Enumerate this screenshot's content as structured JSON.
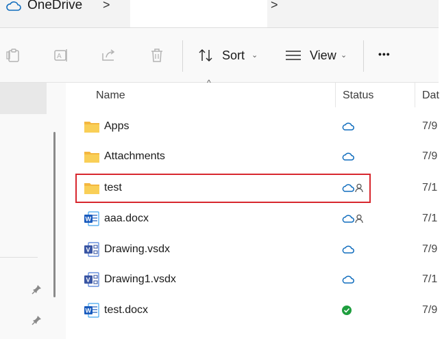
{
  "breadcrumb": {
    "title": "OneDrive",
    "separator": ">"
  },
  "toolbar": {
    "sort_label": "Sort",
    "view_label": "View",
    "more_label": "•••",
    "dropdown_glyph": "⌄",
    "icons": [
      "paste-icon",
      "rename-icon",
      "share-icon",
      "delete-icon",
      "sort-arrows-icon",
      "view-lines-icon",
      "more-icon"
    ]
  },
  "columns": {
    "name": "Name",
    "status": "Status",
    "date": "Dat"
  },
  "sort_indicator": "^",
  "files": [
    {
      "name": "Apps",
      "type": "folder",
      "status": "cloud",
      "date": "7/9"
    },
    {
      "name": "Attachments",
      "type": "folder",
      "status": "cloud",
      "date": "7/9"
    },
    {
      "name": "test",
      "type": "folder",
      "status": "cloud-shared",
      "date": "7/1",
      "highlighted": true
    },
    {
      "name": "aaa.docx",
      "type": "word",
      "status": "cloud-shared",
      "date": "7/1"
    },
    {
      "name": "Drawing.vsdx",
      "type": "visio",
      "status": "cloud",
      "date": "7/9"
    },
    {
      "name": "Drawing1.vsdx",
      "type": "visio",
      "status": "cloud",
      "date": "7/1"
    },
    {
      "name": "test.docx",
      "type": "word",
      "status": "synced",
      "date": "7/9"
    }
  ],
  "colors": {
    "accent": "#0f6cbd",
    "folder": "#f8c74f",
    "word": "#185abd",
    "visio": "#3955a3",
    "synced": "#1e9e3e",
    "highlight": "#d7262d"
  }
}
